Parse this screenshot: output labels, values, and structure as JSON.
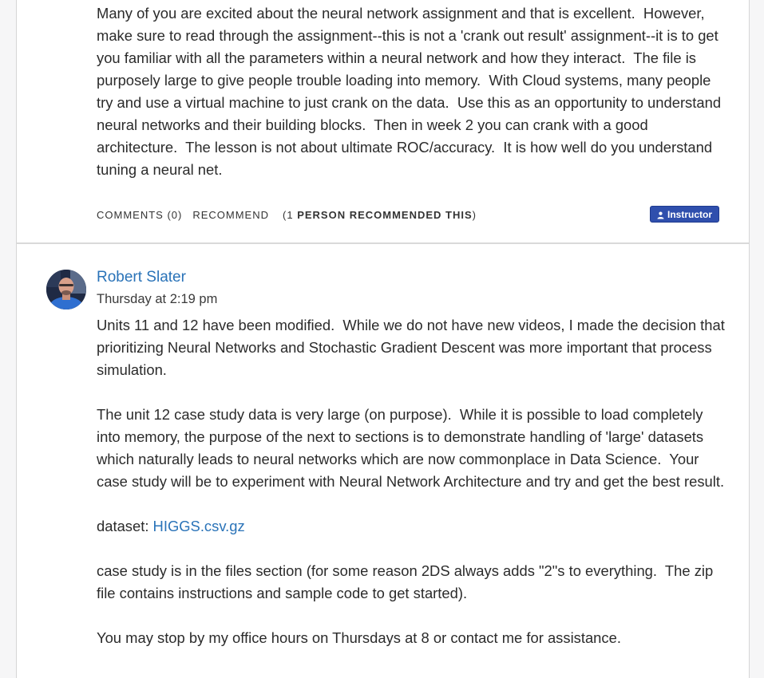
{
  "post1": {
    "body": "Many of you are excited about the neural network assignment and that is excellent.  However, make sure to read through the assignment--this is not a 'crank out result' assignment--it is to get you familiar with all the parameters within a neural network and how they interact.  The file is purposely large to give people trouble loading into memory.  With Cloud systems, many people try and use a virtual machine to just crank on the data.  Use this as an opportunity to understand neural networks and their building blocks.  Then in week 2 you can crank with a good architecture.  The lesson is not about ultimate ROC/accuracy.  It is how well do you understand tuning a neural net.",
    "comments_label": "COMMENTS (0)",
    "recommend_label": "RECOMMEND",
    "rec_prefix": "(1 ",
    "rec_bold": "PERSON RECOMMENDED THIS",
    "rec_suffix": ")",
    "badge_label": "Instructor"
  },
  "post2": {
    "author": "Robert Slater",
    "timestamp": "Thursday at 2:19 pm",
    "para1": "Units 11 and 12 have been modified.  While we do not have new videos, I made the decision that prioritizing Neural Networks and Stochastic Gradient Descent was more important that process simulation.",
    "para2": "The unit 12 case study data is very large (on purpose).  While it is possible to load completely into memory, the purpose of the next to sections is to demonstrate handling of 'large' datasets which naturally leads to neural networks which are now commonplace in Data Science.  Your case study will be to experiment with Neural Network Architecture and try and get the best result.",
    "dataset_prefix": "dataset: ",
    "dataset_link": "HIGGS.csv.gz",
    "para4": "case study is in the files section (for some reason 2DS always adds \"2\"s to everything.  The zip file contains instructions and sample code to get started).",
    "para5": "You may stop by my office hours on Thursdays at 8 or contact me for assistance."
  },
  "colors": {
    "link": "#2a73b8",
    "badge_bg": "#2f4fad",
    "text": "#2b2b2b"
  },
  "icons": {
    "badge": "person-icon",
    "avatar": "user-photo"
  }
}
